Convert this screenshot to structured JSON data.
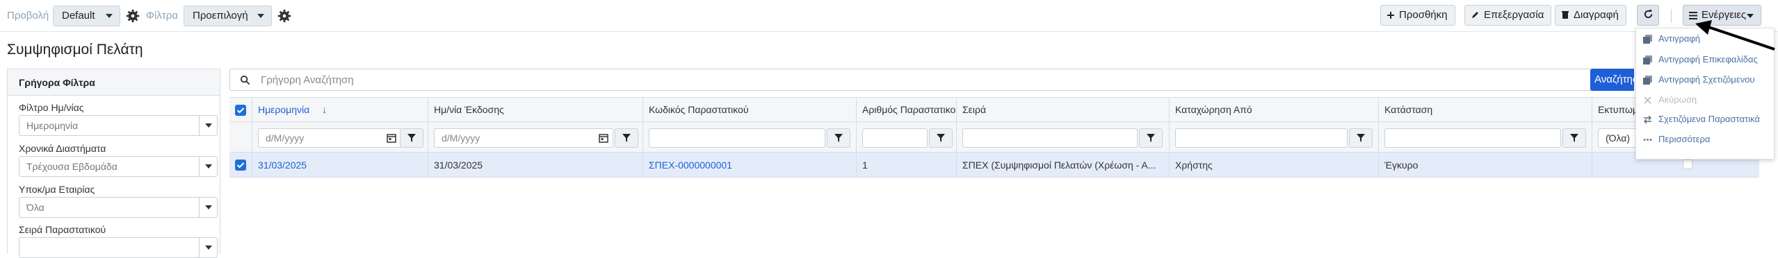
{
  "toolbar": {
    "view_label": "Προβολή",
    "view_value": "Default",
    "filter_label": "Φίλτρα",
    "filter_value": "Προεπιλογή",
    "add_label": "Προσθήκη",
    "edit_label": "Επεξεργασία",
    "delete_label": "Διαγραφή",
    "actions_label": "Ενέργειες"
  },
  "page": {
    "title": "Συμψηφισμοί Πελάτη"
  },
  "filters_panel": {
    "title": "Γρήγορα Φίλτρα",
    "fields": [
      {
        "label": "Φίλτρο Ημ/νίας",
        "value": "Ημερομηνία"
      },
      {
        "label": "Χρονικά Διαστήματα",
        "value": "Τρέχουσα Εβδομάδα"
      },
      {
        "label": "Υποκ/μα Εταιρίας",
        "value": "Όλα"
      },
      {
        "label": "Σειρά Παραστατικού",
        "value": ""
      }
    ]
  },
  "search": {
    "placeholder": "Γρήγορη Αναζήτηση",
    "button_label": "Αναζήτηση"
  },
  "grid": {
    "columns": [
      "Ημερομηνία",
      "Ημ/νία Έκδοσης",
      "Κωδικός Παραστατικού",
      "Αριθμός Παραστατικού",
      "Σειρά",
      "Καταχώρηση Από",
      "Κατάσταση",
      "Εκτυπωμένο"
    ],
    "filter_placeholders": {
      "date": "d/M/yyyy",
      "issue_date": "d/M/yyyy",
      "printed": "(Όλα)"
    },
    "rows": [
      {
        "date": "31/03/2025",
        "issue_date": "31/03/2025",
        "code": "ΣΠΕΧ-0000000001",
        "number": "1",
        "series": "ΣΠΕΧ (Συμψηφισμοί Πελατών (Χρέωση - Α...",
        "entered_by": "Χρήστης",
        "status": "Έγκυρο",
        "selected": true
      }
    ]
  },
  "actions_menu": {
    "items": [
      {
        "label": "Αντιγραφή",
        "icon": "copy-icon",
        "enabled": true
      },
      {
        "label": "Αντιγραφή Επικεφαλίδας",
        "icon": "copy-icon",
        "enabled": true
      },
      {
        "label": "Αντιγραφή Σχετιζόμενου",
        "icon": "copy-icon",
        "enabled": true
      },
      {
        "label": "Ακύρωση",
        "icon": "x-icon",
        "enabled": false
      },
      {
        "label": "Σχετιζόμενα Παραστατικά",
        "icon": "swap-arrows-icon",
        "enabled": true
      },
      {
        "label": "Περισσότερα",
        "icon": "more-dots-icon",
        "enabled": true
      }
    ]
  },
  "colors": {
    "accent": "#1f5fd6",
    "selected_row": "#e4ecf9",
    "header_bg": "#f4f6f8"
  }
}
